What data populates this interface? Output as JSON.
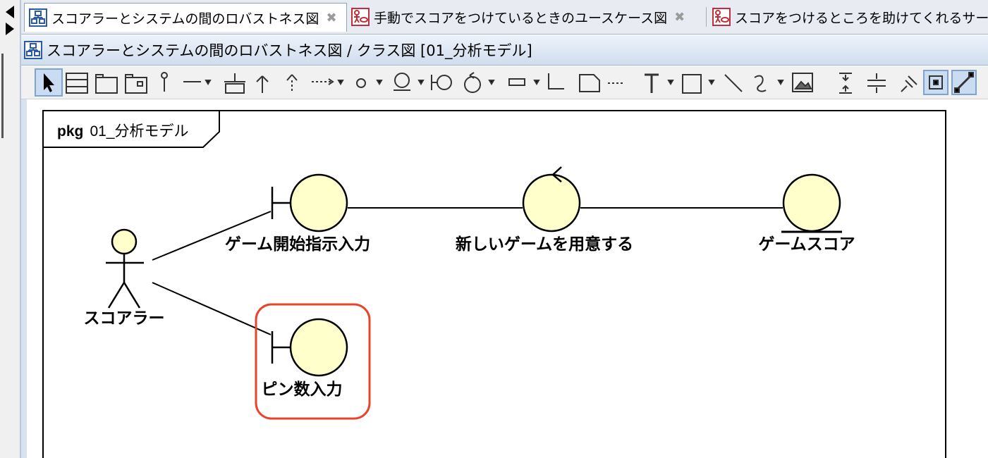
{
  "tabs": [
    {
      "label": "スコアラーとシステムの間のロバストネス図",
      "active": true,
      "icon": "class-diagram-icon"
    },
    {
      "label": "手動でスコアをつけているときのユースケース図",
      "active": false,
      "icon": "usecase-diagram-icon"
    },
    {
      "label": "スコアをつけるところを助けてくれるサービ",
      "active": false,
      "icon": "usecase-diagram-icon"
    }
  ],
  "diagram_title": "スコアラーとシステムの間のロバストネス図 / クラス図 [01_分析モデル]",
  "toolbar": {
    "icons": [
      "select-tool-icon",
      "class-tool-icon",
      "package-tool-icon",
      "subsystem-tool-icon",
      "interface-tool-icon",
      "association-tool-icon",
      "association-class-tool-icon",
      "generalization-tool-icon",
      "realization-tool-icon",
      "dependency-tool-icon",
      "note-circle-tool-icon",
      "boundary-tool-icon",
      "boundary-interface-tool-icon",
      "control-tool-icon",
      "text-field-tool-icon",
      "corner-tool-icon",
      "note-tool-icon",
      "note-anchor-tool-icon",
      "text-tool-icon",
      "rectangle-tool-icon",
      "line-tool-icon",
      "freehand-tool-icon",
      "image-tool-icon",
      "vertical-align-icon",
      "horizontal-align-icon",
      "pin-icon",
      "toggle-view-icon",
      "line-style-icon"
    ]
  },
  "diagram": {
    "package": {
      "keyword": "pkg",
      "name": "01_分析モデル"
    },
    "actor": {
      "label": "スコアラー"
    },
    "boundary1": {
      "label": "ゲーム開始指示入力"
    },
    "control": {
      "label": "新しいゲームを用意する"
    },
    "entity": {
      "label": "ゲームスコア"
    },
    "boundary2": {
      "label": "ピン数入力"
    },
    "highlight_color": "#e8442a",
    "element_fill": "#ffffcc"
  }
}
